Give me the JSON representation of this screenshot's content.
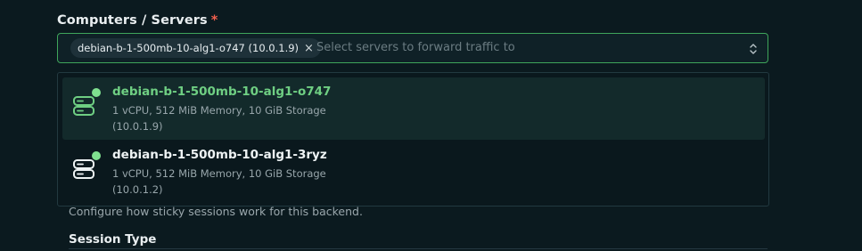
{
  "field": {
    "label": "Computers / Servers",
    "required_marker": "*",
    "selected_chip": "debian-b-1-500mb-10-alg1-o747 (10.0.1.9)",
    "chip_remove": "×",
    "placeholder": "Select servers to forward traffic to"
  },
  "options": [
    {
      "name": "debian-b-1-500mb-10-alg1-o747",
      "specs": "1 vCPU, 512 MiB Memory, 10 GiB Storage",
      "ip": "(10.0.1.9)",
      "status": "online",
      "selected": true
    },
    {
      "name": "debian-b-1-500mb-10-alg1-3ryz",
      "specs": "1 vCPU, 512 MiB Memory, 10 GiB Storage",
      "ip": "(10.0.1.2)",
      "status": "online",
      "selected": false
    }
  ],
  "background": {
    "help_text": "Configure how sticky sessions work for this backend.",
    "session_type_label": "Session Type"
  },
  "colors": {
    "accent": "#3fa55b",
    "status_online": "#7fe08f",
    "selected_text": "#6fcf83"
  },
  "icons": {
    "chip_remove": "close-icon",
    "caret": "chevron-updown-icon",
    "server": "server-icon",
    "status": "status-dot-icon"
  }
}
